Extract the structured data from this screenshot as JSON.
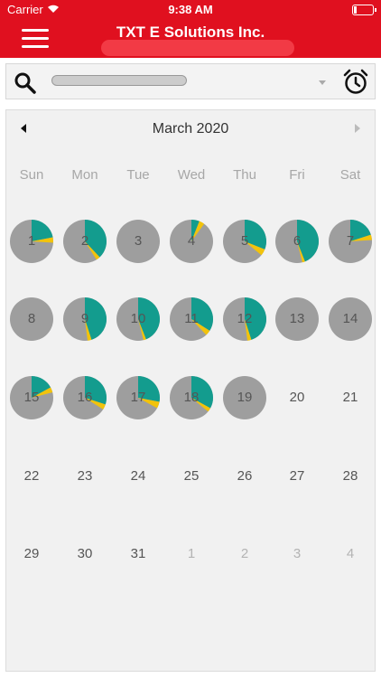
{
  "status_bar": {
    "carrier": "Carrier",
    "time": "9:38 AM"
  },
  "header": {
    "title": "TXT E Solutions Inc."
  },
  "search": {
    "value": ""
  },
  "calendar": {
    "month_label": "March 2020",
    "weekdays": [
      "Sun",
      "Mon",
      "Tue",
      "Wed",
      "Thu",
      "Fri",
      "Sat"
    ],
    "colors": {
      "gray": "#9e9e9e",
      "teal": "#139c8e",
      "yellow": "#f2c30b"
    },
    "weeks": [
      [
        {
          "day": "1",
          "teal": 0.22,
          "yellow": 0.04
        },
        {
          "day": "2",
          "teal": 0.38,
          "yellow": 0.03
        },
        {
          "day": "3",
          "teal": 0,
          "yellow": 0
        },
        {
          "day": "4",
          "teal": 0.06,
          "yellow": 0.04
        },
        {
          "day": "5",
          "teal": 0.31,
          "yellow": 0.05
        },
        {
          "day": "6",
          "teal": 0.44,
          "yellow": 0.02
        },
        {
          "day": "7",
          "teal": 0.2,
          "yellow": 0.04
        }
      ],
      [
        {
          "day": "8",
          "teal": 0,
          "yellow": 0
        },
        {
          "day": "9",
          "teal": 0.45,
          "yellow": 0.03
        },
        {
          "day": "10",
          "teal": 0.44,
          "yellow": 0.02
        },
        {
          "day": "11",
          "teal": 0.34,
          "yellow": 0.04
        },
        {
          "day": "12",
          "teal": 0.45,
          "yellow": 0.03
        },
        {
          "day": "13",
          "teal": 0,
          "yellow": 0
        },
        {
          "day": "14",
          "teal": 0,
          "yellow": 0
        }
      ],
      [
        {
          "day": "15",
          "teal": 0.17,
          "yellow": 0.04
        },
        {
          "day": "16",
          "teal": 0.3,
          "yellow": 0.04
        },
        {
          "day": "17",
          "teal": 0.28,
          "yellow": 0.05
        },
        {
          "day": "18",
          "teal": 0.33,
          "yellow": 0.03
        },
        {
          "day": "19",
          "teal": 0,
          "yellow": 0
        },
        {
          "day": "20",
          "empty": true
        },
        {
          "day": "21",
          "empty": true
        }
      ],
      [
        {
          "day": "22",
          "empty": true
        },
        {
          "day": "23",
          "empty": true
        },
        {
          "day": "24",
          "empty": true
        },
        {
          "day": "25",
          "empty": true
        },
        {
          "day": "26",
          "empty": true
        },
        {
          "day": "27",
          "empty": true
        },
        {
          "day": "28",
          "empty": true
        }
      ],
      [
        {
          "day": "29",
          "empty": true
        },
        {
          "day": "30",
          "empty": true
        },
        {
          "day": "31",
          "empty": true
        },
        {
          "day": "1",
          "empty": true,
          "other": true
        },
        {
          "day": "2",
          "empty": true,
          "other": true
        },
        {
          "day": "3",
          "empty": true,
          "other": true
        },
        {
          "day": "4",
          "empty": true,
          "other": true
        }
      ]
    ]
  }
}
